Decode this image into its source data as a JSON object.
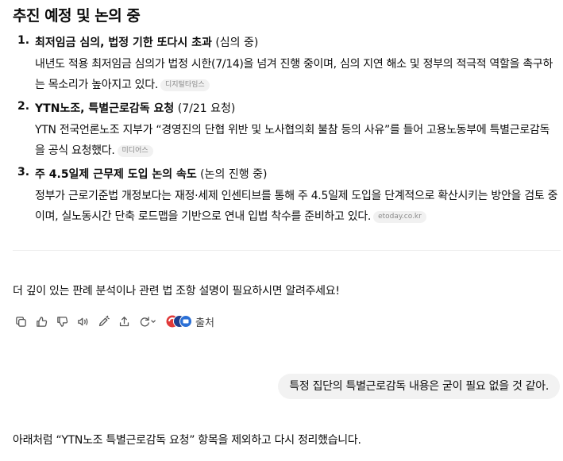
{
  "heading": "추진 예정 및 논의 중",
  "items": [
    {
      "num": "1.",
      "title_bold": "최저임금 심의, 법정 기한 또다시 초과",
      "title_note": " (심의 중)",
      "body": "내년도 적용 최저임금 심의가 법정 시한(7/14)을 넘겨 진행 중이며, 심의 지연 해소 및 정부의 적극적 역할을 촉구하는 목소리가 높아지고 있다.",
      "source": "디지털타임스"
    },
    {
      "num": "2.",
      "title_bold": "YTN노조, 특별근로감독 요청",
      "title_note": " (7/21 요청)",
      "body": "YTN 전국언론노조 지부가 “경영진의 단협 위반 및 노사협의회 불참 등의 사유”를 들어 고용노동부에 특별근로감독을 공식 요청했다.",
      "source": "미디어스"
    },
    {
      "num": "3.",
      "title_bold": "주 4.5일제 근무제 도입 논의 속도",
      "title_note": " (논의 진행 중)",
      "body": "정부가 근로기준법 개정보다는 재정·세제 인센티브를 통해 주 4.5일제 도입을 단계적으로 확산시키는 방안을 검토 중이며, 실노동시간 단축 로드맵을 기반으로 연내 입법 착수를 준비하고 있다.",
      "source": "etoday.co.kr"
    }
  ],
  "closing": "더 깊이 있는 판례 분석이나 관련 법 조항 설명이 필요하시면 알려주세요!",
  "toolbar": {
    "icons": [
      "copy-icon",
      "thumbs-up-icon",
      "thumbs-down-icon",
      "speaker-icon",
      "edit-icon",
      "share-icon",
      "regenerate-icon"
    ],
    "sources_label": "출처"
  },
  "user_message": "특정 집단의 특별근로감독 내용은 굳이 필요 없을 것 같아.",
  "assistant_reply": "아래처럼 “YTN노조 특별근로감독 요청” 항목을 제외하고 다시 정리했습니다."
}
